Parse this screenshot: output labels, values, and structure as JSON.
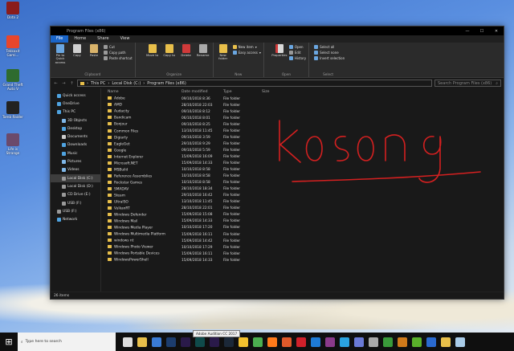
{
  "desktop": {
    "icons": [
      {
        "label": "Dota 2",
        "color": "#8a1c1c"
      },
      {
        "label": "Tekkaxit Gami...",
        "color": "#e8462c"
      },
      {
        "label": "Grand Theft Auto V",
        "color": "#2e6b2e"
      },
      {
        "label": "Tomb Raider",
        "color": "#222222"
      },
      {
        "label": "Life is Strange",
        "color": "#6b4a6b"
      }
    ]
  },
  "explorer": {
    "title": "Program Files (x86)",
    "window_controls": [
      "—",
      "☐",
      "✕"
    ],
    "ribbon_tabs": [
      "File",
      "Home",
      "Share",
      "View"
    ],
    "ribbon": {
      "clipboard": {
        "pin": "Pin to Quick access",
        "copy": "Copy",
        "paste": "Paste",
        "cut": "Cut",
        "copy_path": "Copy path",
        "paste_shortcut": "Paste shortcut",
        "label": "Clipboard"
      },
      "organize": {
        "move_to": "Move to",
        "copy_to": "Copy to",
        "delete": "Delete",
        "rename": "Rename",
        "label": "Organize"
      },
      "new": {
        "new_folder": "New folder",
        "new_item": "New item",
        "easy_access": "Easy access",
        "label": "New"
      },
      "open": {
        "properties": "Properties",
        "open": "Open",
        "edit": "Edit",
        "history": "History",
        "label": "Open"
      },
      "select": {
        "select_all": "Select all",
        "select_none": "Select none",
        "invert": "Invert selection",
        "label": "Select"
      }
    },
    "address": {
      "back": "←",
      "forward": "→",
      "up": "↑",
      "path": [
        "This PC",
        "Local Disk (C:)",
        "Program Files (x86)"
      ],
      "search_placeholder": "Search Program Files (x86)"
    },
    "nav_pane": [
      {
        "label": "Quick access",
        "icon": "star-icon",
        "color": "#4fa3e0",
        "indent": 0
      },
      {
        "label": "OneDrive",
        "icon": "cloud-icon",
        "color": "#4fa3e0",
        "indent": 0
      },
      {
        "label": "This PC",
        "icon": "pc-icon",
        "color": "#4fa3e0",
        "indent": 0
      },
      {
        "label": "3D Objects",
        "icon": "cube-icon",
        "color": "#7fb7e8",
        "indent": 1
      },
      {
        "label": "Desktop",
        "icon": "desktop-icon",
        "color": "#4fa3e0",
        "indent": 1
      },
      {
        "label": "Documents",
        "icon": "document-icon",
        "color": "#cccccc",
        "indent": 1
      },
      {
        "label": "Downloads",
        "icon": "download-icon",
        "color": "#4fa3e0",
        "indent": 1
      },
      {
        "label": "Music",
        "icon": "music-icon",
        "color": "#4fa3e0",
        "indent": 1
      },
      {
        "label": "Pictures",
        "icon": "picture-icon",
        "color": "#7fb7e8",
        "indent": 1
      },
      {
        "label": "Videos",
        "icon": "video-icon",
        "color": "#7fb7e8",
        "indent": 1
      },
      {
        "label": "Local Disk (C:)",
        "icon": "drive-icon",
        "color": "#999999",
        "indent": 1,
        "selected": true
      },
      {
        "label": "Local Disk (D:)",
        "icon": "drive-icon",
        "color": "#999999",
        "indent": 1
      },
      {
        "label": "CD Drive (E:)",
        "icon": "cd-icon",
        "color": "#999999",
        "indent": 1
      },
      {
        "label": "USB (F:)",
        "icon": "usb-icon",
        "color": "#999999",
        "indent": 1
      },
      {
        "label": "USB (F:)",
        "icon": "usb-icon",
        "color": "#999999",
        "indent": 0
      },
      {
        "label": "Network",
        "icon": "network-icon",
        "color": "#4fa3e0",
        "indent": 0
      }
    ],
    "columns": [
      "Name",
      "Date modified",
      "Type",
      "Size"
    ],
    "files": [
      {
        "name": "Adobe",
        "date": "09/10/2018 8:36",
        "type": "File folder"
      },
      {
        "name": "AMD",
        "date": "28/10/2018 22:03",
        "type": "File folder"
      },
      {
        "name": "Audacity",
        "date": "09/10/2018 8:12",
        "type": "File folder"
      },
      {
        "name": "Bandicam",
        "date": "06/10/2018 8:01",
        "type": "File folder"
      },
      {
        "name": "Bonjour",
        "date": "09/10/2018 8:25",
        "type": "File folder"
      },
      {
        "name": "Common Files",
        "date": "13/10/2018 11:45",
        "type": "File folder"
      },
      {
        "name": "Digiarty",
        "date": "09/10/2018 3:59",
        "type": "File folder"
      },
      {
        "name": "EagleGet",
        "date": "29/10/2018 9:29",
        "type": "File folder"
      },
      {
        "name": "Google",
        "date": "09/10/2018 5:59",
        "type": "File folder"
      },
      {
        "name": "Internet Explorer",
        "date": "15/09/2018 16:09",
        "type": "File folder"
      },
      {
        "name": "Microsoft.NET",
        "date": "15/09/2018 14:33",
        "type": "File folder"
      },
      {
        "name": "MSBuild",
        "date": "10/10/2018 8:58",
        "type": "File folder"
      },
      {
        "name": "Reference Assemblies",
        "date": "10/10/2018 8:58",
        "type": "File folder"
      },
      {
        "name": "Rockstar Games",
        "date": "10/10/2018 8:58",
        "type": "File folder"
      },
      {
        "name": "SMADAV",
        "date": "28/10/2018 18:34",
        "type": "File folder"
      },
      {
        "name": "Steam",
        "date": "29/10/2018 16:42",
        "type": "File folder"
      },
      {
        "name": "UltraISO",
        "date": "13/10/2018 11:45",
        "type": "File folder"
      },
      {
        "name": "VulkanRT",
        "date": "28/10/2018 22:01",
        "type": "File folder"
      },
      {
        "name": "Windows Defender",
        "date": "15/09/2018 15:08",
        "type": "File folder"
      },
      {
        "name": "Windows Mail",
        "date": "15/09/2018 14:33",
        "type": "File folder"
      },
      {
        "name": "Windows Media Player",
        "date": "10/10/2018 17:20",
        "type": "File folder"
      },
      {
        "name": "Windows Multimedia Platform",
        "date": "15/09/2018 16:11",
        "type": "File folder"
      },
      {
        "name": "windows nt",
        "date": "15/09/2018 14:42",
        "type": "File folder"
      },
      {
        "name": "Windows Photo Viewer",
        "date": "10/10/2018 17:29",
        "type": "File folder"
      },
      {
        "name": "Windows Portable Devices",
        "date": "15/09/2018 16:11",
        "type": "File folder"
      },
      {
        "name": "WindowsPowerShell",
        "date": "15/09/2018 14:33",
        "type": "File folder"
      }
    ],
    "status": "26 items"
  },
  "annotation": {
    "text": "kosong",
    "color": "#d42020"
  },
  "taskbar": {
    "search_placeholder": "Type here to search",
    "tooltip": "Adobe Audition CC 2017",
    "apps": [
      {
        "name": "task-view-icon",
        "color": "#dddddd"
      },
      {
        "name": "file-explorer-icon",
        "color": "#e8bf4a"
      },
      {
        "name": "store-icon",
        "color": "#3a7bd5"
      },
      {
        "name": "photoshop-icon",
        "color": "#1c3d6e"
      },
      {
        "name": "premiere-icon",
        "color": "#2a1a4a"
      },
      {
        "name": "audition-icon",
        "color": "#0f4a4a"
      },
      {
        "name": "after-effects-icon",
        "color": "#2a1a4a"
      },
      {
        "name": "steam-icon",
        "color": "#1b2838"
      },
      {
        "name": "rockstar-icon",
        "color": "#f2c12e"
      },
      {
        "name": "chrome-icon",
        "color": "#4caf50"
      },
      {
        "name": "firefox-icon",
        "color": "#ff7a1a"
      },
      {
        "name": "media-icon",
        "color": "#e05a2a"
      },
      {
        "name": "opera-icon",
        "color": "#d0202a"
      },
      {
        "name": "edge-icon",
        "color": "#1e7bd6"
      },
      {
        "name": "winrar-icon",
        "color": "#8a3a8a"
      },
      {
        "name": "telegram-icon",
        "color": "#2aa3e0"
      },
      {
        "name": "discord-icon",
        "color": "#6a7ad6"
      },
      {
        "name": "game-icon",
        "color": "#aaaaaa"
      },
      {
        "name": "bandicam-icon",
        "color": "#3a9a3a"
      },
      {
        "name": "audacity-icon",
        "color": "#d07a1a"
      },
      {
        "name": "utorrent-icon",
        "color": "#5ab02a"
      },
      {
        "name": "idm-icon",
        "color": "#2a6ad0"
      },
      {
        "name": "folder-icon",
        "color": "#e8bf4a"
      },
      {
        "name": "notepad-icon",
        "color": "#aacce8"
      }
    ]
  }
}
